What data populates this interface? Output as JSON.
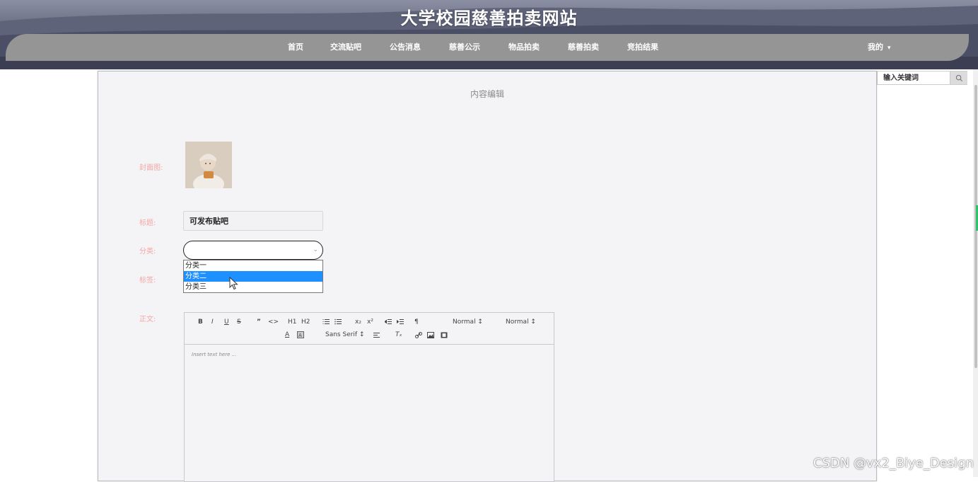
{
  "site": {
    "title": "大学校园慈善拍卖网站"
  },
  "nav": {
    "items": [
      "首页",
      "交流贴吧",
      "公告消息",
      "慈善公示",
      "物品拍卖",
      "慈善拍卖",
      "竞拍结果"
    ],
    "user_menu": "我的",
    "user_caret": "▾"
  },
  "search": {
    "placeholder": "输入关键词"
  },
  "form": {
    "panel_title": "内容编辑",
    "cover_label": "封面图:",
    "title_label": "标题:",
    "title_value": "可发布贴吧",
    "category_label": "分类:",
    "category_options": [
      "分类一",
      "分类二",
      "分类三"
    ],
    "category_highlighted": "分类二",
    "tags_label": "标签:",
    "body_label": "正文:"
  },
  "editor": {
    "toolbar_row1": [
      "B",
      "I",
      "U",
      "S",
      "”",
      "<>",
      "H1",
      "H2",
      "OL",
      "UL",
      "x₂",
      "x²",
      "outdent",
      "indent",
      "¶"
    ],
    "header_select": "Normal ↕",
    "size_select": "Normal ↕",
    "font_select": "Sans Serif ↕",
    "placeholder": "Insert text here ..."
  },
  "watermark": "CSDN @vx2_Biye_Design",
  "colors": {
    "nav_bg": "#959595",
    "label": "#f4a6a6",
    "highlight": "#1e90ff",
    "panel_bg": "#f4f4f6"
  }
}
